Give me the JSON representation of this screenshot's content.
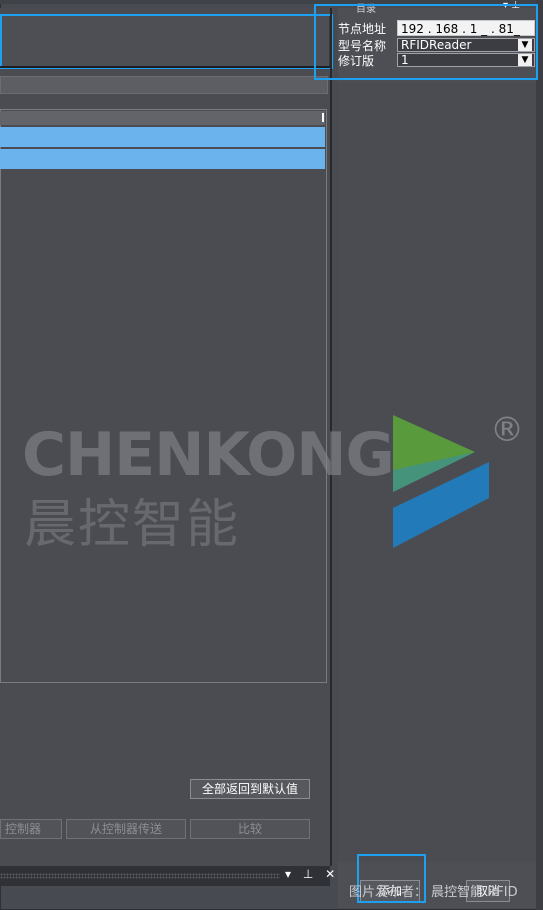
{
  "properties": {
    "node_address_label": "节点地址",
    "node_address_value": "192 . 168 . 1 _ . 81_",
    "model_name_label": "型号名称",
    "model_name_value": "RFIDReader",
    "revision_label": "修订版",
    "revision_value": "1"
  },
  "buttons": {
    "restore_defaults": "全部返回到默认值",
    "transfer_to_controller": "控制器",
    "transfer_from_controller": "从控制器传送",
    "compare": "比较",
    "add": "添加",
    "cancel": "取消"
  },
  "panel_caption": "目录",
  "bottom_bar_icons": "▾ ⊥ ✕",
  "watermark": {
    "brand_en": "CHENKONG",
    "brand_cn": "晨控智能",
    "registered": "®"
  },
  "footer": "图片发布者： 晨控智能 RFID",
  "colors": {
    "highlight_row": "#6bb3ec",
    "focus_outline": "#1ea0f0",
    "logo_green": "#5aa33a",
    "logo_blue": "#1f7fc4"
  }
}
